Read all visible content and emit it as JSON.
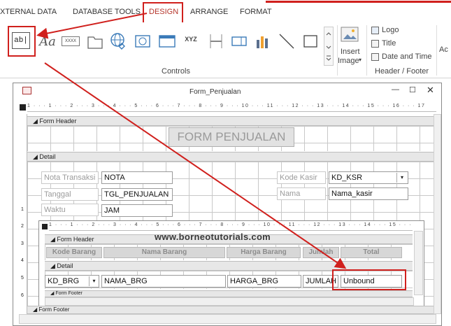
{
  "ribbon": {
    "tabs": [
      "XTERNAL DATA",
      "DATABASE TOOLS",
      "DESIGN",
      "ARRANGE",
      "FORMAT"
    ],
    "selected_tab": "DESIGN",
    "controls_group_label": "Controls",
    "textbox_icon_text": "ab|",
    "label_icon_text": "Aa",
    "xxxx_icon_text": "XXXX",
    "xyz_icon_text": "XYZ",
    "insert_image_line1": "Insert",
    "insert_image_line2": "Image",
    "header_footer": {
      "logo": "Logo",
      "title": "Title",
      "date_time": "Date and Time",
      "group_label": "Header / Footer"
    },
    "cut_label": "Ac"
  },
  "window": {
    "title": "Form_Penjualan",
    "ruler_text": "1 · · · 1 · · · 2 · · · 3 · · · 4 · · · 5 · · · 6 · · · 7 · · · 8 · · · 9 · · · 10 · · · 11 · · · 12 · · · 13 · · · 14 · · · 15 · · · 16 · · · 17",
    "sub_ruler_text": "1 · · · 1 · · · 2 · · · 3 · · · 4 · · · 5 · · · 6 · · · 7 · · · 8 · · · 9 · · · 10 · · · 11 · · · 12 · · · 13 · · · 14 · · · 15 · · · 16",
    "form_header_band": "Form Header",
    "detail_band": "Detail",
    "form_footer_band": "Form Footer",
    "form_title": "FORM PENJUALAN",
    "fields": {
      "nota_label": "Nota Transaksi",
      "nota_value": "NOTA",
      "tanggal_label": "Tanggal",
      "tanggal_value": "TGL_PENJUALAN",
      "waktu_label": "Waktu",
      "waktu_value": "JAM",
      "kasir_label": "Kode Kasir",
      "kasir_value": "KD_KSR",
      "nama_label": "Nama",
      "nama_value": "Nama_kasir"
    },
    "vruler_numbers": [
      "1",
      "2",
      "3",
      "4",
      "5",
      "6"
    ]
  },
  "subform": {
    "form_header_band": "Form Header",
    "detail_band": "Detail",
    "form_footer_band": "Form Footer",
    "columns": [
      "Kode Barang",
      "Nama Barang",
      "Harga Barang",
      "Jumlah",
      "Total"
    ],
    "values": {
      "kd": "KD_BRG",
      "nama": "NAMA_BRG",
      "harga": "HARGA_BRG",
      "jumlah": "JUMLAH",
      "total": "Unbound"
    }
  },
  "watermark": "www.borneotutorials.com",
  "colors": {
    "highlight": "#d0201d",
    "tab_active": "#c0392b"
  }
}
